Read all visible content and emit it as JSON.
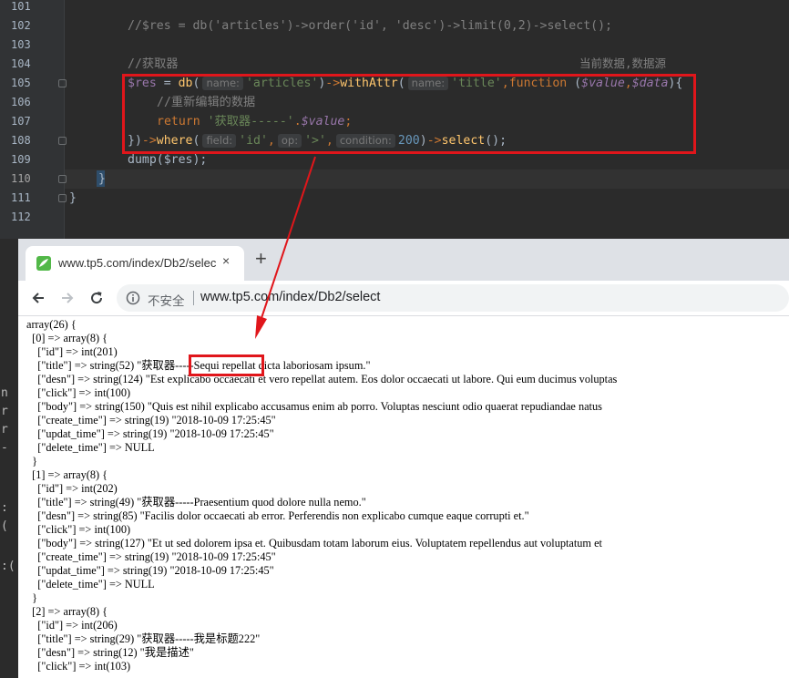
{
  "editor": {
    "line_numbers": [
      "101",
      "102",
      "103",
      "104",
      "105",
      "106",
      "107",
      "108",
      "109",
      "110",
      "111",
      "112"
    ],
    "current_line": "110",
    "lines": {
      "l102": "//$res = db('articles')->order('id', 'desc')->limit(0,2)->select();",
      "l104": "//获取器",
      "l104_right": "当前数据,数据源",
      "l105": {
        "var": "$res",
        "eq": " = ",
        "fn1": "db",
        "p1": "(",
        "hint_name": "name:",
        "arg1": "'articles'",
        "p2": ")",
        "arrow1": "->",
        "fn2": "withAttr",
        "p3": "(",
        "hint_name2": "name:",
        "arg2": "'title'",
        "comma": ",",
        "kw_function": "function",
        "p4": " (",
        "param1": "$value",
        "comma2": ",",
        "param2": "$data",
        "p5": "){"
      },
      "l106": "//重新编辑的数据",
      "l107": {
        "kw_return": "return",
        "str": "'获取器-----'",
        "dot": ".",
        "var": "$value",
        "semi": ";"
      },
      "l108": {
        "close": "})",
        "arrow": "->",
        "fn": "where",
        "p1": "(",
        "hint_field": "field:",
        "arg1": "'id'",
        "c1": ",",
        "hint_op": "op:",
        "arg2": "'>'",
        "c2": ",",
        "hint_cond": "condition:",
        "arg3": "200",
        "p2": ")",
        "arrow2": "->",
        "fn2": "select",
        "p3": "();"
      },
      "l109": "dump($res);",
      "l110": "}",
      "l111": "}"
    }
  },
  "console_strip": [
    "n",
    "r",
    "r",
    "-",
    ":",
    "(",
    ":("
  ],
  "browser": {
    "tab_title": "www.tp5.com/index/Db2/selec",
    "tab_close": "×",
    "new_tab": "+",
    "security_label": "不安全",
    "url": "www.tp5.com/index/Db2/select",
    "accent": "#1a73e8"
  },
  "output": {
    "lines": [
      "array(26) {",
      "  [0] => array(8) {",
      "    [\"id\"] => int(201)",
      "    [\"title\"] => string(52) \"获取器-----Sequi repellat dicta laboriosam ipsum.\"",
      "    [\"desn\"] => string(124) \"Est explicabo occaecati et vero repellat autem. Eos dolor occaecati ut labore. Qui eum ducimus voluptas",
      "    [\"click\"] => int(100)",
      "    [\"body\"] => string(150) \"Quis est nihil explicabo accusamus enim ab porro. Voluptas nesciunt odio quaerat repudiandae natus",
      "    [\"create_time\"] => string(19) \"2018-10-09 17:25:45\"",
      "    [\"updat_time\"] => string(19) \"2018-10-09 17:25:45\"",
      "    [\"delete_time\"] => NULL",
      "  }",
      "  [1] => array(8) {",
      "    [\"id\"] => int(202)",
      "    [\"title\"] => string(49) \"获取器-----Praesentium quod dolore nulla nemo.\"",
      "    [\"desn\"] => string(85) \"Facilis dolor occaecati ab error. Perferendis non explicabo cumque eaque corrupti et.\"",
      "    [\"click\"] => int(100)",
      "    [\"body\"] => string(127) \"Et ut sed dolorem ipsa et. Quibusdam totam laborum eius. Voluptatem repellendus aut voluptatum et",
      "    [\"create_time\"] => string(19) \"2018-10-09 17:25:45\"",
      "    [\"updat_time\"] => string(19) \"2018-10-09 17:25:45\"",
      "    [\"delete_time\"] => NULL",
      "  }",
      "  [2] => array(8) {",
      "    [\"id\"] => int(206)",
      "    [\"title\"] => string(29) \"获取器-----我是标题222\"",
      "    [\"desn\"] => string(12) \"我是描述\"",
      "    [\"click\"] => int(103)"
    ]
  },
  "colors": {
    "highlight_box": "#e0161b",
    "arrow": "#e0161b",
    "ide_bg": "#2b2b2b"
  }
}
